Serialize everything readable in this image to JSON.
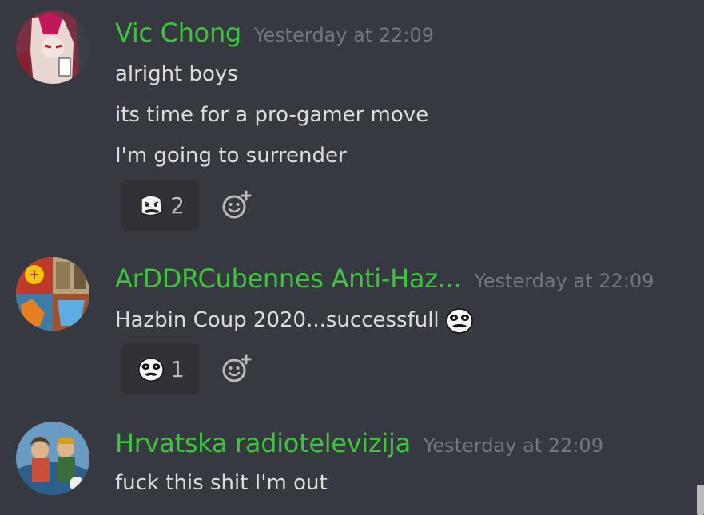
{
  "messages": [
    {
      "username": "Vic Chong",
      "timestamp": "Yesterday at 22:09",
      "avatar_icon": "anime-character-avatar",
      "lines": [
        "alright boys",
        "its time for a pro-gamer move",
        "I'm going to surrender"
      ],
      "reaction": {
        "emoji": "rage-face-emoji",
        "count": "2"
      },
      "add_reaction_icon": "add-reaction-icon"
    },
    {
      "username": "ArDDRCubennes Anti-Haz...",
      "timestamp": "Yesterday at 22:09",
      "avatar_icon": "propaganda-poster-avatar",
      "lines": [
        "Hazbin Coup 2020...successfull"
      ],
      "inline_emoji": "me-gusta-face-emoji",
      "reaction": {
        "emoji": "me-gusta-face-emoji",
        "count": "1"
      },
      "add_reaction_icon": "add-reaction-icon"
    },
    {
      "username": "Hrvatska radiotelevizija",
      "timestamp": "Yesterday at 22:09",
      "avatar_icon": "painted-figures-avatar",
      "lines": [
        "fuck this shit I'm out"
      ]
    }
  ],
  "colors": {
    "background": "#36393f",
    "username": "#3cc43c",
    "timestamp": "#72767d",
    "text": "#dcddde",
    "reaction_bg": "#2f3136"
  }
}
